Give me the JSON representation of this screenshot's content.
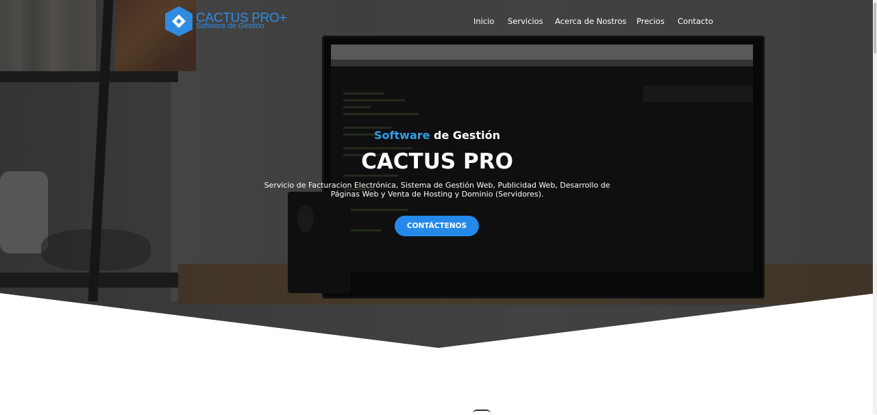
{
  "brand": {
    "name": "CACTUS PRO+",
    "subtitle": "Software de Gestión",
    "color": "#2f8ce0"
  },
  "nav": {
    "items": [
      {
        "label": "Inicio"
      },
      {
        "label": "Servicios"
      },
      {
        "label": "Acerca de Nostros"
      },
      {
        "label": "Precios"
      },
      {
        "label": "Contacto"
      }
    ]
  },
  "hero": {
    "tagline_accent": "Software",
    "tagline_rest": " de Gestión",
    "title": "CACTUS PRO",
    "description": "Servicio de Facturacion Electrónica, Sistema de Gestión Web, Publicidad Web, Desarrollo de Páginas Web y Venta de Hosting y Dominio (Servidores).",
    "cta_label": "CONTÁCTENOS",
    "accent_color": "#2f9ee8",
    "button_color": "#2589ea"
  }
}
